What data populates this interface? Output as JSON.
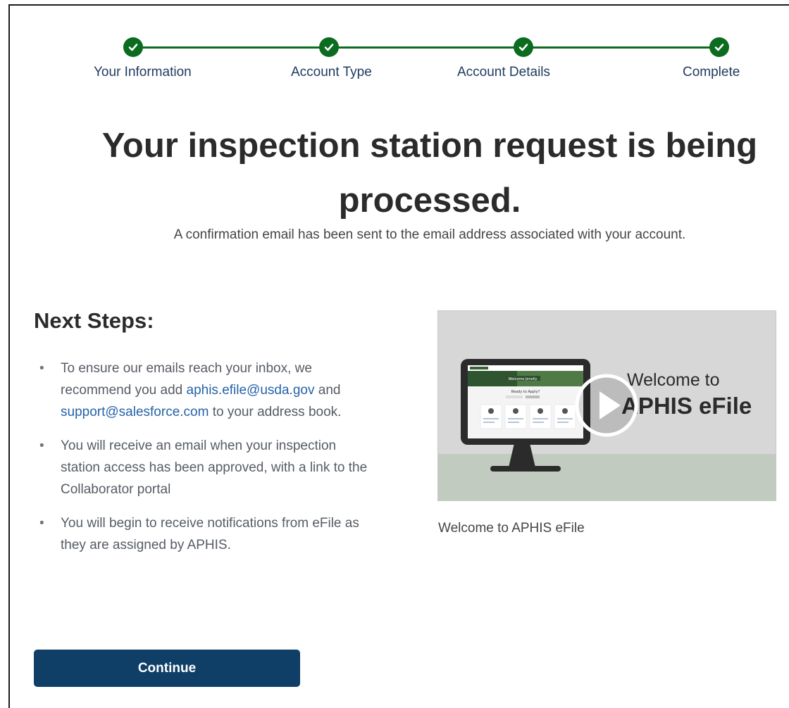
{
  "progress": {
    "steps": [
      {
        "label": "Your Information",
        "status": "complete"
      },
      {
        "label": "Account Type",
        "status": "complete"
      },
      {
        "label": "Account Details",
        "status": "complete"
      },
      {
        "label": "Complete",
        "status": "complete"
      }
    ],
    "color": "#0b6b1f"
  },
  "headline": {
    "line1": "Your inspection station request is being",
    "line2": "processed."
  },
  "subline": "A confirmation email has been sent to the email address associated with your account.",
  "next_steps": {
    "title": "Next Steps:",
    "item1": {
      "before": "To ensure our emails reach your inbox, we recommend you add ",
      "link1": "aphis.efile@usda.gov",
      "middle": " and ",
      "link2": "support@salesforce.com",
      "after": " to your address book."
    },
    "item2": "You will receive an email when your inspection station access has been approved, with a link to the Collaborator portal",
    "item3": "You will begin to receive notifications from eFile as they are assigned by APHIS."
  },
  "continue_label": "Continue",
  "video": {
    "title_small": "Welcome to",
    "title_big": "APHIS eFile",
    "caption": "Welcome to APHIS eFile",
    "thumb_heading": "Welcome Jenelly",
    "thumb_sub": "Ready to Apply?"
  },
  "colors": {
    "button": "#0f3e66",
    "link": "#2563a8",
    "check": "#0b6b1f"
  }
}
